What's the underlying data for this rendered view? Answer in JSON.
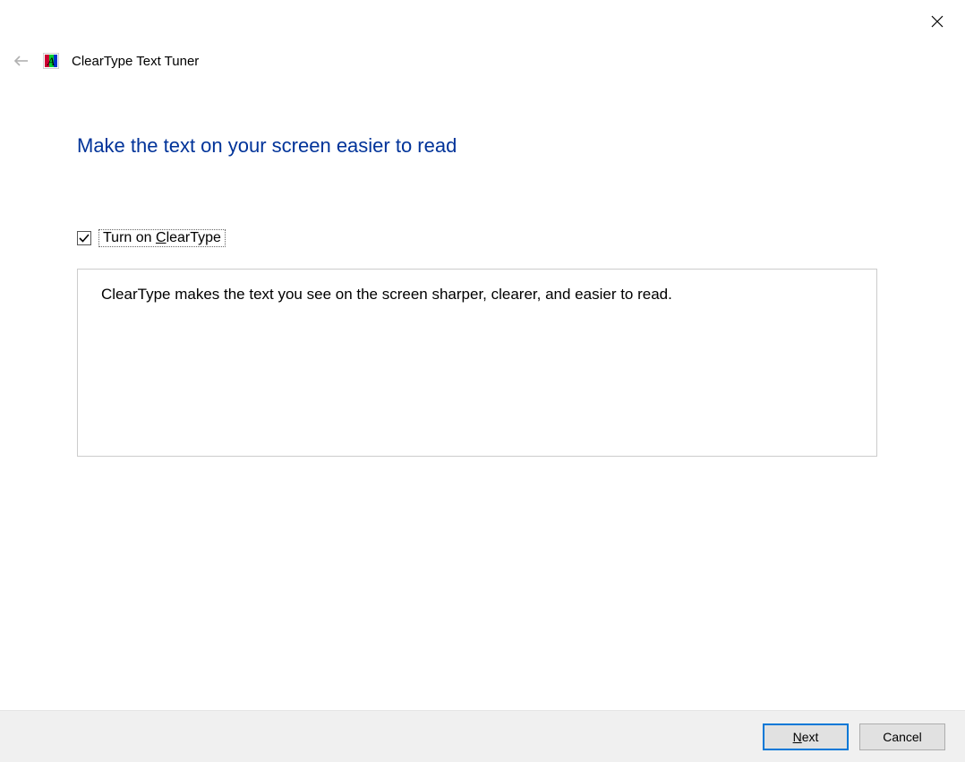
{
  "window": {
    "title": "ClearType Text Tuner"
  },
  "page": {
    "heading": "Make the text on your screen easier to read",
    "checkbox": {
      "checked": true,
      "label_before": "Turn on ",
      "label_key": "C",
      "label_after": "learType"
    },
    "description": "ClearType makes the text you see on the screen sharper, clearer, and easier to read."
  },
  "buttons": {
    "next_key": "N",
    "next_rest": "ext",
    "cancel": "Cancel"
  }
}
